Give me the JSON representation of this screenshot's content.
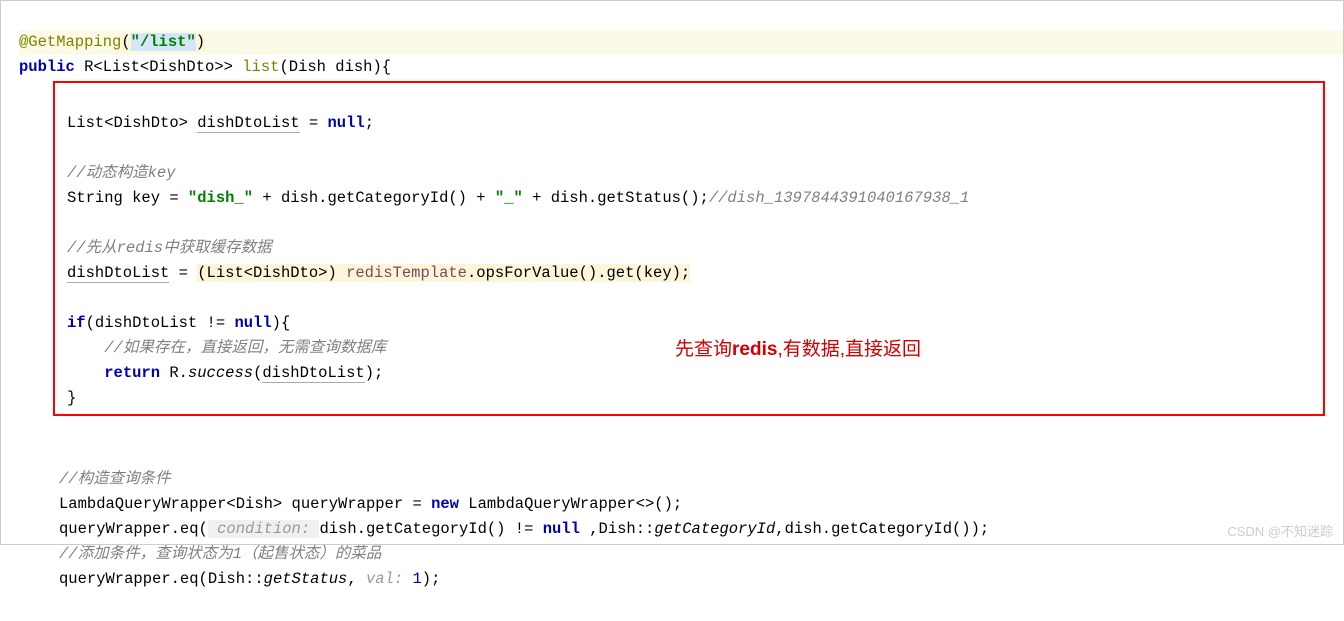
{
  "line1": {
    "annot": "@GetMapping",
    "paren_open": "(",
    "arg": "\"/list\"",
    "paren_close": ")"
  },
  "line2": {
    "p1": "public",
    "p2": " R<List<DishDto>> ",
    "method": "list",
    "sig": "(Dish dish){"
  },
  "box": {
    "l1a": "List<DishDto> ",
    "l1b": "dishDtoList",
    "l1c": " = ",
    "l1d": "null",
    "l1e": ";",
    "cm1": "//动态构造key",
    "l2a": "String key = ",
    "l2b": "\"dish_\"",
    "l2c": " + dish.getCategoryId() + ",
    "l2d": "\"_\"",
    "l2e": " + dish.getStatus();",
    "l2f": "//dish_1397844391040167938_1",
    "cm2": "//先从redis中获取缓存数据",
    "l3a": "dishDtoList",
    "l3b": " = ",
    "l3c": "(List<DishDto>) ",
    "l3d": "redisTemplate",
    "l3e": ".opsForValue().get(key);",
    "l4a": "if",
    "l4b": "(dishDtoList != ",
    "l4c": "null",
    "l4d": "){",
    "cm3": "//如果存在，直接返回，无需查询数据库",
    "l5a": "return",
    "l5b": " R.",
    "l5c": "success",
    "l5d": "(",
    "l5e": "dishDtoList",
    "l5f": ");",
    "l6": "}"
  },
  "after": {
    "cm1": "//构造查询条件",
    "l1a": "LambdaQueryWrapper<Dish> queryWrapper = ",
    "l1b": "new",
    "l1c": " LambdaQueryWrapper<>();",
    "l2a": "queryWrapper.eq(",
    "l2hint": " condition: ",
    "l2b": "dish.getCategoryId() != ",
    "l2c": "null",
    "l2d": " ,Dish::",
    "l2e": "getCategoryId",
    "l2f": ",dish.getCategoryId());",
    "cm2": "//添加条件，查询状态为1（起售状态）的菜品",
    "l3a": "queryWrapper.eq(Dish::",
    "l3b": "getStatus",
    "l3c": ", ",
    "l3hint": "val: ",
    "l3d": "1",
    "l3e": ");"
  },
  "annotation_red": {
    "t1": "先查询",
    "t2": "redis",
    "t3": ",有数据,直接返回"
  },
  "watermark": "CSDN @不知迷踪"
}
